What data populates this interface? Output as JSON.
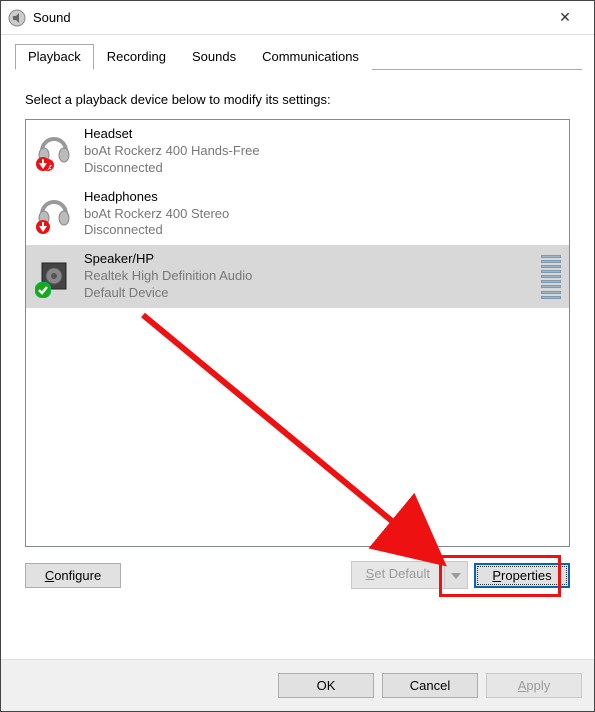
{
  "window": {
    "title": "Sound",
    "close_label": "✕"
  },
  "tabs": {
    "playback": "Playback",
    "recording": "Recording",
    "sounds": "Sounds",
    "communications": "Communications"
  },
  "instructions": "Select a playback device below to modify its settings:",
  "devices": [
    {
      "name": "Headset",
      "sub": "boAt Rockerz 400 Hands-Free",
      "status": "Disconnected",
      "badge": "down"
    },
    {
      "name": "Headphones",
      "sub": "boAt Rockerz 400 Stereo",
      "status": "Disconnected",
      "badge": "down"
    },
    {
      "name": "Speaker/HP",
      "sub": "Realtek High Definition Audio",
      "status": "Default Device",
      "badge": "check",
      "selected": true
    }
  ],
  "buttons": {
    "configure_u": "C",
    "configure_rest": "onfigure",
    "set_default_u": "S",
    "set_default_rest": "et Default",
    "properties_u": "P",
    "properties_rest": "roperties",
    "ok": "OK",
    "cancel": "Cancel",
    "apply_u": "A",
    "apply_rest": "pply"
  }
}
